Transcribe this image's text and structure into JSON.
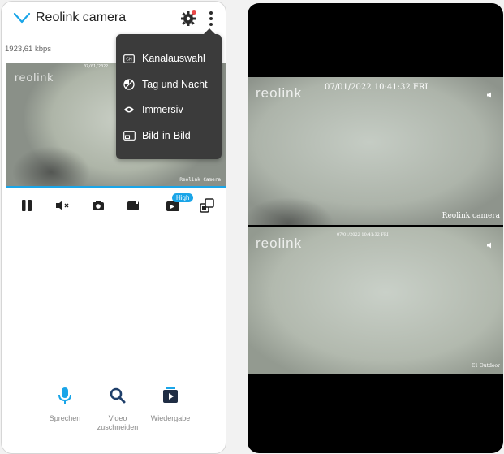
{
  "left_screen": {
    "title": "Reolink camera",
    "bitrate": "1923,61 kbps",
    "video": {
      "watermark": "reolink",
      "timestamp": "07/01/2022",
      "camera_label": "Reolink Camera"
    },
    "quality_badge": "High",
    "controls": [
      {
        "name": "pause",
        "icon": "pause-icon"
      },
      {
        "name": "mute",
        "icon": "speaker-muted-icon"
      },
      {
        "name": "snapshot",
        "icon": "camera-icon"
      },
      {
        "name": "record",
        "icon": "video-record-icon"
      },
      {
        "name": "quality",
        "icon": "quality-icon"
      },
      {
        "name": "multiview",
        "icon": "multiview-icon"
      }
    ],
    "menu": {
      "items": [
        {
          "label": "Kanalauswahl",
          "icon": "channel-icon"
        },
        {
          "label": "Tag und Nacht",
          "icon": "day-night-icon"
        },
        {
          "label": "Immersiv",
          "icon": "eye-icon"
        },
        {
          "label": "Bild-in-Bild",
          "icon": "picture-in-picture-icon"
        }
      ]
    },
    "bottom_actions": [
      {
        "label": "Sprechen",
        "icon": "microphone-icon"
      },
      {
        "label": "Video\nzuschneiden",
        "icon": "search-icon"
      },
      {
        "label": "Wiedergabe",
        "icon": "playback-icon"
      }
    ]
  },
  "right_screen": {
    "top_video": {
      "watermark": "reolink",
      "timestamp": "07/01/2022 10:41:32 FRI",
      "camera_label": "Reolink camera"
    },
    "bottom_video": {
      "watermark": "reolink",
      "timestamp": "07/01/2022 10:41:32 FRI",
      "camera_label": "E1 Outdoor"
    }
  },
  "colors": {
    "accent": "#1aa5e8",
    "menu_bg": "#3b3b3b",
    "gear_dot": "#e94848"
  }
}
